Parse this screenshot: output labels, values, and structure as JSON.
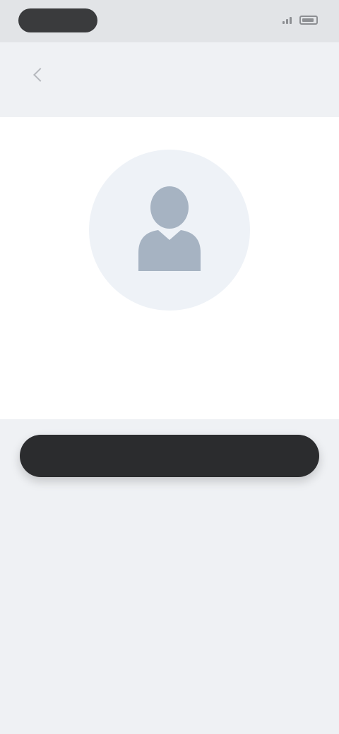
{
  "status_bar": {
    "time": "",
    "icons": [
      "signal-icon",
      "battery-icon"
    ]
  },
  "header": {
    "title": "",
    "back_icon": "chevron-left-icon"
  },
  "card": {
    "illustration_icon": "person-icon",
    "title": "",
    "description": ""
  },
  "primary_button": {
    "label": ""
  },
  "secondary_link": {
    "label": ""
  },
  "colors": {
    "background": "#eff1f4",
    "card": "#ffffff",
    "primary_button": "#2b2c2e",
    "avatar_background": "#eef2f7",
    "icon": "#a3b0bf"
  }
}
